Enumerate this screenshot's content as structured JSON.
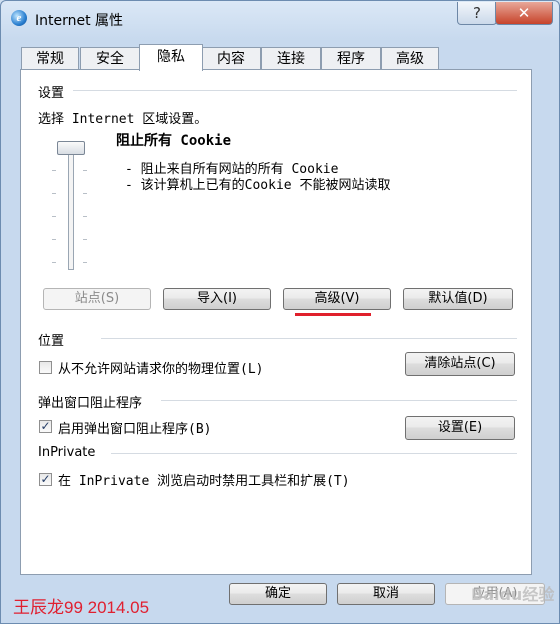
{
  "window": {
    "title": "Internet 属性",
    "help_label": "?",
    "close_label": "✕",
    "app_icon": "ie-icon"
  },
  "tabs": [
    "常规",
    "安全",
    "隐私",
    "内容",
    "连接",
    "程序",
    "高级"
  ],
  "settings": {
    "group_label": "设置",
    "zone_prompt": "选择 Internet 区域设置。",
    "level_title": "阻止所有 Cookie",
    "bullets": [
      "- 阻止来自所有网站的所有 Cookie",
      "- 该计算机上已有的Cookie 不能被网站读取"
    ],
    "buttons": {
      "sites": "站点(S)",
      "import": "导入(I)",
      "advanced": "高级(V)",
      "default": "默认值(D)"
    }
  },
  "location": {
    "group_label": "位置",
    "checkbox_label": "从不允许网站请求你的物理位置(L)",
    "checked": false,
    "clear_button": "清除站点(C)"
  },
  "popup": {
    "group_label": "弹出窗口阻止程序",
    "checkbox_label": "启用弹出窗口阻止程序(B)",
    "checked": true,
    "settings_button": "设置(E)"
  },
  "inprivate": {
    "group_label": "InPrivate",
    "checkbox_label": "在 InPrivate 浏览启动时禁用工具栏和扩展(T)",
    "checked": true
  },
  "footer": {
    "ok": "确定",
    "cancel": "取消",
    "apply": "应用(A)"
  },
  "overlay": {
    "watermark": "王辰龙99 2014.05",
    "logo": "Baidu经验"
  },
  "colors": {
    "annotation_underline": "#e0202c",
    "watermark": "#e02030"
  }
}
